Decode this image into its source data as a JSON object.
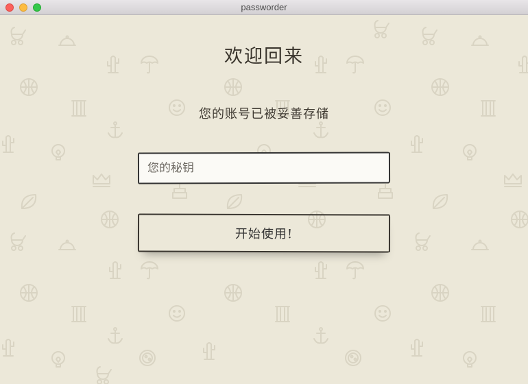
{
  "window": {
    "title": "passworder"
  },
  "main": {
    "heading": "欢迎回来",
    "subheading": "您的账号已被妥善存储",
    "key_input": {
      "placeholder": "您的秘钥",
      "value": ""
    },
    "start_button_label": "开始使用!"
  },
  "background": {
    "pattern_color": "#d9d4c3",
    "icons": [
      "stroller-icon",
      "cloche-icon",
      "cactus-icon",
      "umbrella-icon",
      "ball-icon",
      "smiley-icon",
      "anchor-icon",
      "column-icon",
      "lightbulb-icon",
      "crown-icon",
      "leaf-icon",
      "pizza-icon",
      "cake-icon"
    ]
  }
}
